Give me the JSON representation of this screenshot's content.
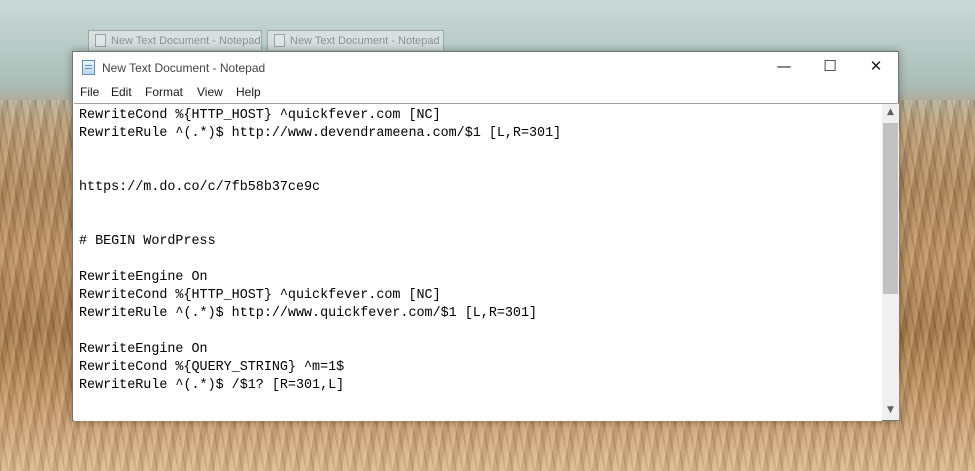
{
  "background_tabs": [
    {
      "title": "New Text Document - Notepad"
    },
    {
      "title": "New Text Document - Notepad"
    }
  ],
  "window": {
    "title": "New Text Document - Notepad",
    "icon": "notepad-icon",
    "controls": {
      "minimize": "—",
      "maximize": "☐",
      "close": "✕"
    }
  },
  "menu": [
    "File",
    "Edit",
    "Format",
    "View",
    "Help"
  ],
  "editor": {
    "lines": [
      "RewriteCond %{HTTP_HOST} ^quickfever.com [NC]",
      "RewriteRule ^(.*)$ http://www.devendrameena.com/$1 [L,R=301]",
      "",
      "",
      "https://m.do.co/c/7fb58b37ce9c",
      "",
      "",
      "# BEGIN WordPress",
      "",
      "RewriteEngine On",
      "RewriteCond %{HTTP_HOST} ^quickfever.com [NC]",
      "RewriteRule ^(.*)$ http://www.quickfever.com/$1 [L,R=301]",
      "",
      "RewriteEngine On",
      "RewriteCond %{QUERY_STRING} ^m=1$",
      "RewriteRule ^(.*)$ /$1? [R=301,L]"
    ]
  },
  "scrollbar": {
    "up": "▲",
    "down": "▼"
  }
}
